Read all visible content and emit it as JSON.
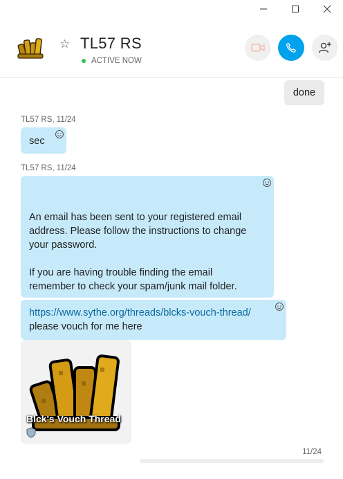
{
  "window": {
    "minimize_icon": "minimize-icon",
    "maximize_icon": "maximize-icon",
    "close_icon": "close-icon"
  },
  "header": {
    "contact_name": "TL57 RS",
    "status": "ACTIVE NOW",
    "status_color": "#2ec74a",
    "call_button_color": "#00a2ed"
  },
  "messages": {
    "outgoing_1": "done",
    "incoming_1": {
      "meta": "TL57 RS, 11/24",
      "text": "sec"
    },
    "incoming_2": {
      "meta": "TL57 RS, 11/24",
      "para1_line1": "An email has been sent to your registered email",
      "para1_line2": "address. Please follow the instructions to change",
      "para1_line3": "your password.",
      "para2_line1": "If you are having trouble finding the email",
      "para2_line2": "remember to check your spam/junk mail folder."
    },
    "incoming_3": {
      "link": "https://www.sythe.org/threads/blcks-vouch-thread/",
      "text": "please vouch for me here"
    },
    "link_preview": {
      "title": "Blck's Vouch Thread"
    },
    "bottom_date": "11/24"
  }
}
